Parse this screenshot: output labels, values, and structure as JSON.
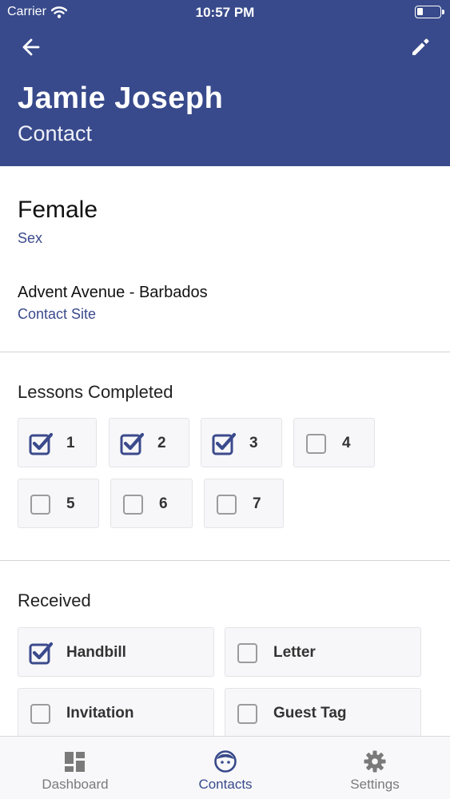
{
  "status_bar": {
    "carrier": "Carrier",
    "time": "10:57 PM"
  },
  "header": {
    "name": "Jamie Joseph",
    "subtitle": "Contact",
    "back_icon": "arrow-left-icon",
    "edit_icon": "pencil-icon"
  },
  "details": {
    "sex": {
      "value": "Female",
      "label": "Sex"
    },
    "site": {
      "value": "Advent Avenue - Barbados",
      "label": "Contact Site"
    }
  },
  "lessons": {
    "title": "Lessons Completed",
    "items": [
      {
        "label": "1",
        "checked": true
      },
      {
        "label": "2",
        "checked": true
      },
      {
        "label": "3",
        "checked": true
      },
      {
        "label": "4",
        "checked": false
      },
      {
        "label": "5",
        "checked": false
      },
      {
        "label": "6",
        "checked": false
      },
      {
        "label": "7",
        "checked": false
      }
    ]
  },
  "received": {
    "title": "Received",
    "items": [
      {
        "label": "Handbill",
        "checked": true
      },
      {
        "label": "Letter",
        "checked": false
      },
      {
        "label": "Invitation",
        "checked": false
      },
      {
        "label": "Guest Tag",
        "checked": false
      }
    ]
  },
  "tabs": [
    {
      "label": "Dashboard",
      "icon": "dashboard-icon",
      "active": false
    },
    {
      "label": "Contacts",
      "icon": "contact-face-icon",
      "active": true
    },
    {
      "label": "Settings",
      "icon": "gear-icon",
      "active": false
    }
  ],
  "colors": {
    "brand": "#384a8b",
    "checkbox": "#3b4a8c",
    "tab_inactive": "#7a7a7a"
  }
}
